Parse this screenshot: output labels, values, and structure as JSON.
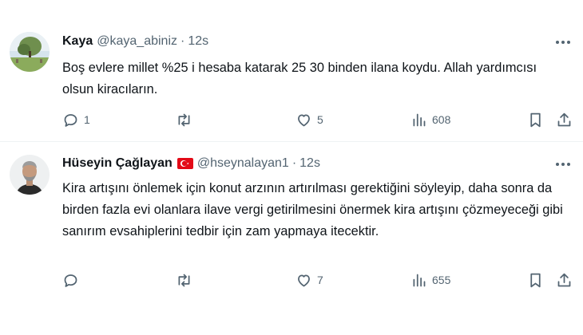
{
  "tweets": [
    {
      "name": "Kaya",
      "handle": "@kaya_abiniz",
      "dot": "·",
      "time": "12s",
      "text": "Boş evlere millet %25 i hesaba katarak 25 30 binden ilana koydu. Allah yardımcısı olsun kiracıların.",
      "replies": "1",
      "reposts": "",
      "likes": "5",
      "views": "608",
      "avatar": "landscape-photo",
      "flag": null
    },
    {
      "name": "Hüseyin Çağlayan",
      "handle": "@hseynalayan1",
      "dot": "·",
      "time": "12s",
      "text": "Kira artışını önlemek için konut arzının artırılması gerektiğini söyleyip, daha sonra da birden fazla evi olanlara ilave vergi getirilmesini önermek kira artışını çözmeyeceği gibi sanırım evsahiplerini tedbir için zam yapmaya itecektir.",
      "replies": "",
      "reposts": "",
      "likes": "7",
      "views": "655",
      "avatar": "man-portrait",
      "flag": "turkey-flag"
    }
  ],
  "icons": {
    "reply": "reply-icon",
    "repost": "repost-icon",
    "like": "like-icon",
    "views": "views-icon",
    "bookmark": "bookmark-icon",
    "share": "share-icon",
    "more": "more-icon"
  },
  "colors": {
    "text": "#0f1419",
    "secondary": "#536471",
    "divider": "#eff3f4",
    "flag_red": "#e30a17"
  }
}
